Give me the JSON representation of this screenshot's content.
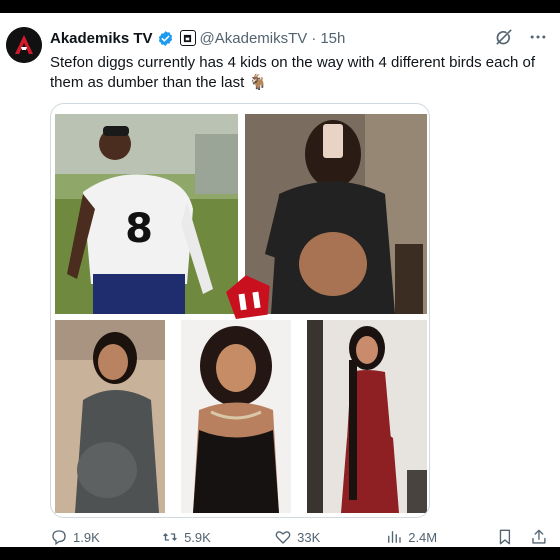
{
  "post": {
    "author_name": "Akademiks TV",
    "handle": "@AkademiksTV",
    "separator": "·",
    "time": "15h",
    "text": "Stefon diggs currently has 4 kids on the way with 4 different birds each of them as dumber than the last 🐐"
  },
  "media": {
    "images": [
      {
        "label": "football player in white number 8 jersey",
        "jersey_number": "8"
      },
      {
        "label": "pregnant woman mirror selfie in black jacket"
      },
      {
        "label": "pregnant woman in gray dress"
      },
      {
        "label": "woman in black lace top"
      },
      {
        "label": "pregnant woman in red dress"
      }
    ]
  },
  "stats": {
    "replies": "1.9K",
    "reposts": "5.9K",
    "likes": "33K",
    "views": "2.4M"
  },
  "icons": [
    "avatar-logo",
    "verified-badge-icon",
    "affiliate-label-icon",
    "grok-icon",
    "more-icon",
    "reply-icon",
    "repost-icon",
    "like-icon",
    "views-icon",
    "bookmark-icon",
    "share-icon"
  ],
  "colors": {
    "verified": "#1d9bf0",
    "text_primary": "#0f1419",
    "text_secondary": "#536471",
    "watermark": "#c8101e"
  }
}
